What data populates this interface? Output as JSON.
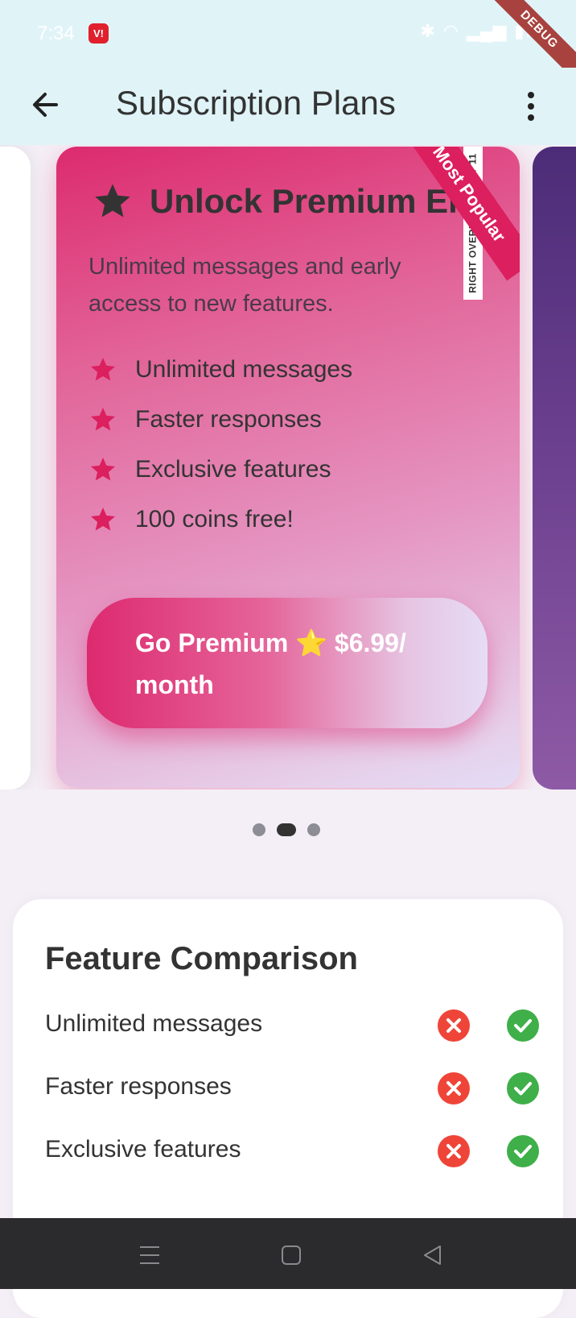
{
  "status_bar": {
    "time": "7:34",
    "app_badge": "V!",
    "battery": "75",
    "debug_label": "DEBUG"
  },
  "app_bar": {
    "title": "Subscription Plans",
    "back_icon": "arrow-back-icon",
    "menu_icon": "more-vertical-icon"
  },
  "plan_card": {
    "title": "Unlock Premium Elite",
    "description": "Unlimited messages and early access to new features.",
    "ribbon": "Most Popular",
    "overflow_warning": "RIGHT OVERFLOWED BY 11",
    "features": [
      "Unlimited messages",
      "Faster responses",
      "Exclusive features",
      "100 coins free!"
    ],
    "cta_label": "Go Premium ⭐ $6.99/ month",
    "colors": {
      "accent": "#dc1f5e",
      "gradient_start": "#dc2b6e",
      "gradient_end": "#e4dcf6"
    }
  },
  "carousel": {
    "page_count": 3,
    "active_index": 1
  },
  "comparison": {
    "title": "Feature Comparison",
    "rows": [
      {
        "label": "Unlimited messages",
        "basic": false,
        "premium": true
      },
      {
        "label": "Faster responses",
        "basic": false,
        "premium": true
      },
      {
        "label": "Exclusive features",
        "basic": false,
        "premium": true
      }
    ],
    "colors": {
      "no": "#ef4538",
      "yes": "#3faf49"
    }
  },
  "nav_bar": {
    "icons": [
      "menu-icon",
      "home-icon",
      "back-triangle-icon"
    ]
  }
}
